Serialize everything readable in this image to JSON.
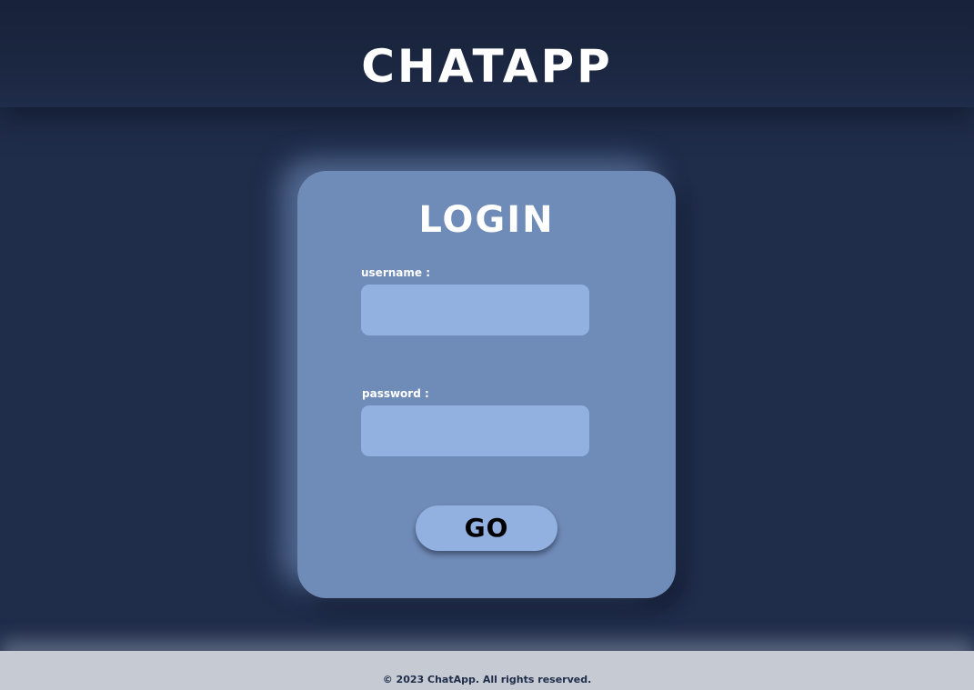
{
  "header": {
    "title": "CHATAPP"
  },
  "login": {
    "title": "LOGIN",
    "username_label": "username :",
    "username_value": "",
    "password_label": "password :",
    "password_value": "",
    "submit_label": "GO"
  },
  "footer": {
    "copyright": "© 2023 ChatApp. All rights reserved."
  },
  "colors": {
    "background": "#1f2c4a",
    "card": "#6f8bb7",
    "input": "#92b1e1",
    "footer": "#c5cad3"
  }
}
